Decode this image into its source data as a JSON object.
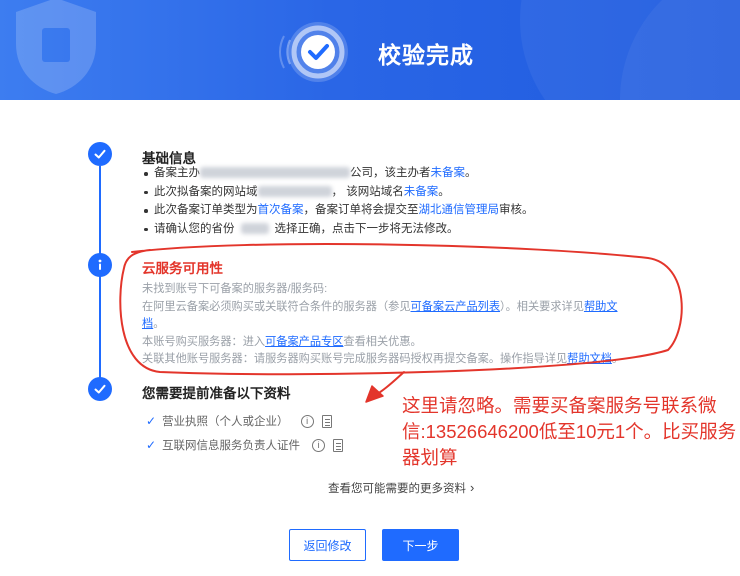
{
  "header": {
    "title": "校验完成",
    "bg_color": "#2a66e6"
  },
  "steps": [
    {
      "icon": "check-circle-icon",
      "title": "基础信息",
      "items": [
        {
          "pre": "备案主办",
          "mid": "公司，该主办者",
          "link": "未备案",
          "post": "。"
        },
        {
          "pre": "此次拟备案的网站域",
          "mid": "， 该网站域名",
          "link": "未备案",
          "post": "。"
        },
        {
          "pre": "此次备案订单类型为",
          "link1": "首次备案",
          "mid": "，备案订单将会提交至",
          "link2": "湖北通信管理局",
          "post": "审核。"
        },
        {
          "pre": "请确认您的省份",
          "post": "选择正确，点击下一步将无法修改。"
        }
      ]
    },
    {
      "icon": "info-circle-icon",
      "title": "云服务可用性",
      "lines": {
        "l1": "未找到账号下可备案的服务器/服务码:",
        "l2_pre": "在阿里云备案必须购买或关联符合条件的服务器（参见",
        "l2_link": "可备案云产品列表",
        "l2_mid": "）。相关要求详见",
        "l2_link2": "帮助文",
        "l3_link": "档",
        "l3_post": "。",
        "l4_pre": "本账号购买服务器：进入",
        "l4_link": "可备案产品专区",
        "l4_post": "查看相关优惠。",
        "l5_pre": "关联其他账号服务器：请服务器购买账号完成服务器码授权再提交备案。操作指导详见",
        "l5_link": "帮助文档",
        "l5_post": "。"
      }
    },
    {
      "icon": "check-circle-icon",
      "title": "您需要提前准备以下资料",
      "materials": [
        "营业执照（个人或企业）",
        "互联网信息服务负责人证件"
      ]
    }
  ],
  "more_link": "查看您可能需要的更多资料",
  "buttons": {
    "back": "返回修改",
    "next": "下一步"
  },
  "annotation": "这里请忽略。需要买备案服务号联系微信:13526646200低至10元1个。比买服务器划算",
  "colors": {
    "primary": "#1f6bff",
    "annotation_red": "#e3352b"
  }
}
